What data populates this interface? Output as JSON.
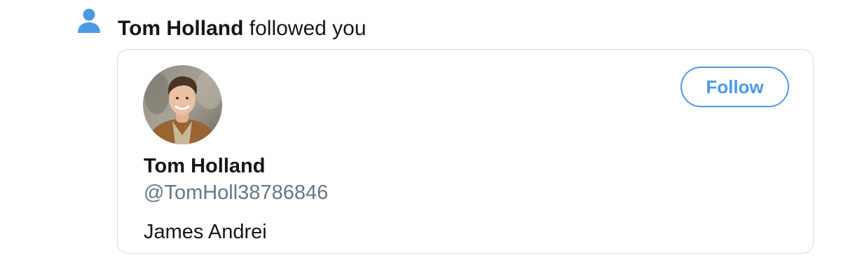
{
  "notification": {
    "icon": "person-icon",
    "actor_name": "Tom Holland",
    "action_text": " followed you"
  },
  "card": {
    "avatar_icon": "profile-photo",
    "follow_label": "Follow",
    "display_name": "Tom Holland",
    "handle": "@TomHoll38786846",
    "bio": "James Andrei"
  },
  "colors": {
    "accent": "#4a99e9",
    "icon_blue": "#4a99e9",
    "text_primary": "#14171a",
    "text_secondary": "#657786",
    "card_border": "#d6dde3"
  }
}
